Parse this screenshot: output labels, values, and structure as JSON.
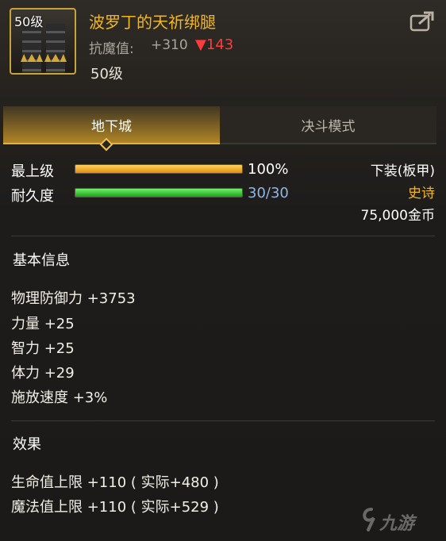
{
  "item": {
    "icon_level_badge": "50级",
    "name": "波罗丁的天祈绑腿",
    "resist_label": "抗魔值:",
    "resist_value": "+310",
    "resist_diff": "▼143",
    "level_text": "50级"
  },
  "tabs": [
    {
      "label": "地下城",
      "active": true
    },
    {
      "label": "决斗模式",
      "active": false
    }
  ],
  "stats": {
    "max_level_label": "最上级",
    "max_level_value": "100%",
    "max_level_fraction": 1.0,
    "durability_label": "耐久度",
    "durability_value": "30/30",
    "durability_fraction": 1.0
  },
  "meta": {
    "slot": "下装(板甲)",
    "rarity": "史诗",
    "price": "75,000金币"
  },
  "basic_info": {
    "title": "基本信息",
    "lines": [
      "物理防御力 +3753",
      "力量 +25",
      "智力 +25",
      "体力 +29",
      "施放速度 +3%"
    ]
  },
  "effects": {
    "title": "效果",
    "lines": [
      "生命值上限 +110 ( 实际+480 )",
      "魔法值上限 +110 ( 实际+529 )"
    ]
  },
  "watermark": "九游",
  "colors": {
    "gold": "#f0b820",
    "epic": "#f0b820",
    "down": "#ff3b3b",
    "durability_text": "#8fb6e3"
  },
  "icons": [
    "share-icon",
    "diamond-marker-icon",
    "jiuyou-logo-icon"
  ]
}
